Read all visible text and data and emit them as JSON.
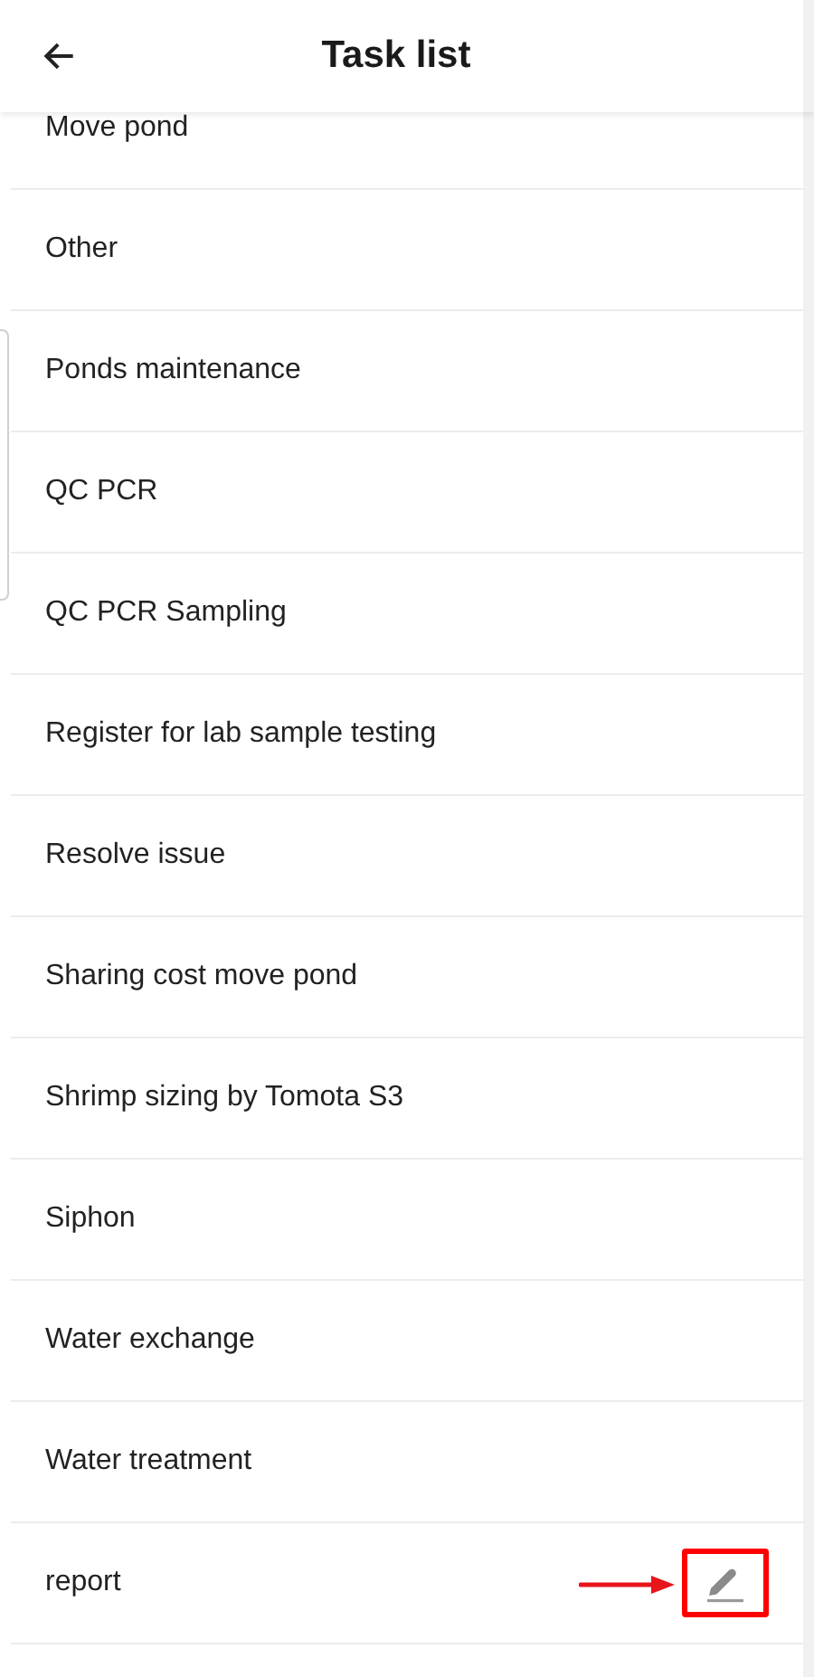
{
  "header": {
    "title": "Task list"
  },
  "tasks": [
    {
      "label": "Move pond",
      "editable": false
    },
    {
      "label": "Other",
      "editable": false
    },
    {
      "label": "Ponds maintenance",
      "editable": false
    },
    {
      "label": "QC PCR",
      "editable": false
    },
    {
      "label": "QC PCR Sampling",
      "editable": false
    },
    {
      "label": "Register for lab sample testing",
      "editable": false
    },
    {
      "label": "Resolve issue",
      "editable": false
    },
    {
      "label": "Sharing cost move pond",
      "editable": false
    },
    {
      "label": "Shrimp sizing by Tomota S3",
      "editable": false
    },
    {
      "label": "Siphon",
      "editable": false
    },
    {
      "label": "Water exchange",
      "editable": false
    },
    {
      "label": "Water treatment",
      "editable": false
    },
    {
      "label": "report",
      "editable": true
    }
  ]
}
